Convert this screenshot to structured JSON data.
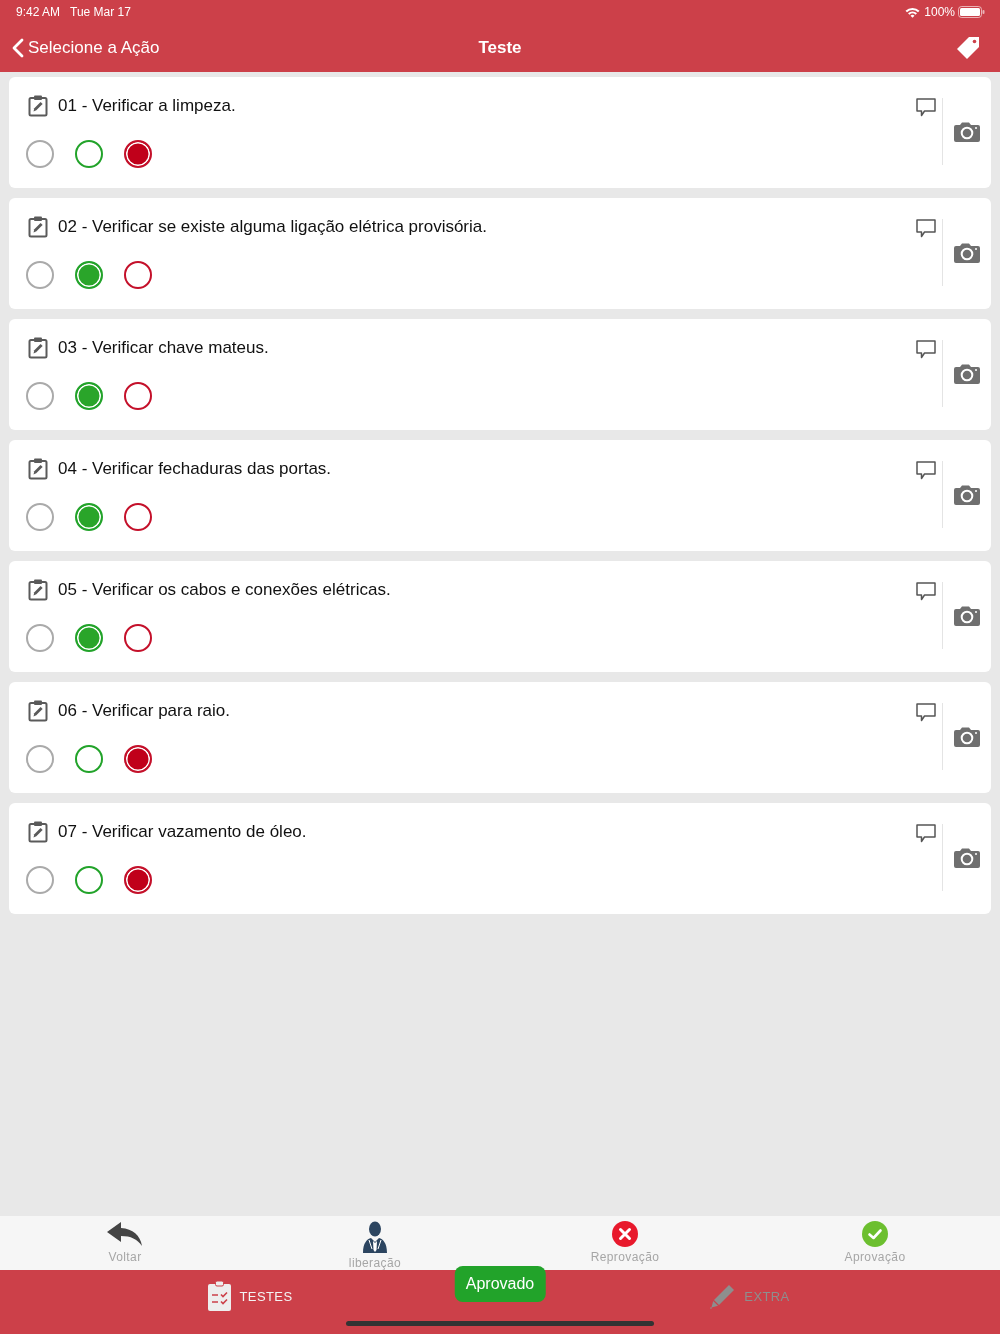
{
  "status_bar": {
    "time": "9:42 AM",
    "date": "Tue Mar 17",
    "battery": "100%"
  },
  "nav_bar": {
    "back_label": "Selecione a Ação",
    "title": "Teste"
  },
  "items": [
    {
      "label": "01 - Verificar a limpeza.",
      "options": [
        {
          "kind": "neutral",
          "selected": false
        },
        {
          "kind": "pass",
          "selected": false
        },
        {
          "kind": "fail",
          "selected": true
        }
      ]
    },
    {
      "label": "02 - Verificar se existe alguma ligação elétrica provisória.",
      "options": [
        {
          "kind": "neutral",
          "selected": false
        },
        {
          "kind": "pass",
          "selected": true
        },
        {
          "kind": "fail",
          "selected": false
        }
      ]
    },
    {
      "label": "03 - Verificar chave mateus.",
      "options": [
        {
          "kind": "neutral",
          "selected": false
        },
        {
          "kind": "pass",
          "selected": true
        },
        {
          "kind": "fail",
          "selected": false
        }
      ]
    },
    {
      "label": "04 - Verificar fechaduras das portas.",
      "options": [
        {
          "kind": "neutral",
          "selected": false
        },
        {
          "kind": "pass",
          "selected": true
        },
        {
          "kind": "fail",
          "selected": false
        }
      ]
    },
    {
      "label": "05 - Verificar os cabos e conexões elétricas.",
      "options": [
        {
          "kind": "neutral",
          "selected": false
        },
        {
          "kind": "pass",
          "selected": true
        },
        {
          "kind": "fail",
          "selected": false
        }
      ]
    },
    {
      "label": "06 - Verificar para raio.",
      "options": [
        {
          "kind": "neutral",
          "selected": false
        },
        {
          "kind": "pass",
          "selected": false
        },
        {
          "kind": "fail",
          "selected": true
        }
      ]
    },
    {
      "label": "07 - Verificar vazamento de óleo.",
      "options": [
        {
          "kind": "neutral",
          "selected": false
        },
        {
          "kind": "pass",
          "selected": false
        },
        {
          "kind": "fail",
          "selected": true
        }
      ]
    }
  ],
  "toolbar": [
    {
      "kind": "back",
      "label": "Voltar"
    },
    {
      "kind": "release",
      "label": "liberação"
    },
    {
      "kind": "reject",
      "label": "Reprovação"
    },
    {
      "kind": "approve",
      "label": "Aprovação"
    }
  ],
  "tabs": [
    {
      "kind": "tests",
      "label": "TESTES",
      "selected": true
    },
    {
      "kind": "extra",
      "label": "EXTRA",
      "selected": false
    }
  ],
  "status_badge": "Aprovado"
}
